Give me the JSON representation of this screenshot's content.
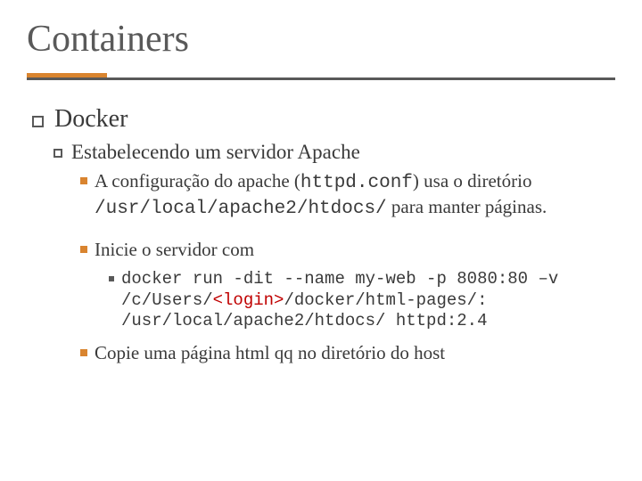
{
  "title": "Containers",
  "l1": "Docker",
  "l2": "Estabelecendo um servidor Apache",
  "l3a_pre": "A configuração do apache (",
  "l3a_code1": "httpd.conf",
  "l3a_mid": ") usa o diretório ",
  "l3a_code2": "/usr/local/apache2/htdocs/",
  "l3a_post": " para manter páginas.",
  "l3b": "Inicie o servidor com",
  "cmd_p1": "docker run -dit --name my-web -p 8080:80 –v /c/Users/",
  "cmd_login": "<login>",
  "cmd_p2": "/docker/html-pages/: /usr/local/apache2/htdocs/ httpd:2.4",
  "l3c": "Copie uma página html qq no diretório do host"
}
